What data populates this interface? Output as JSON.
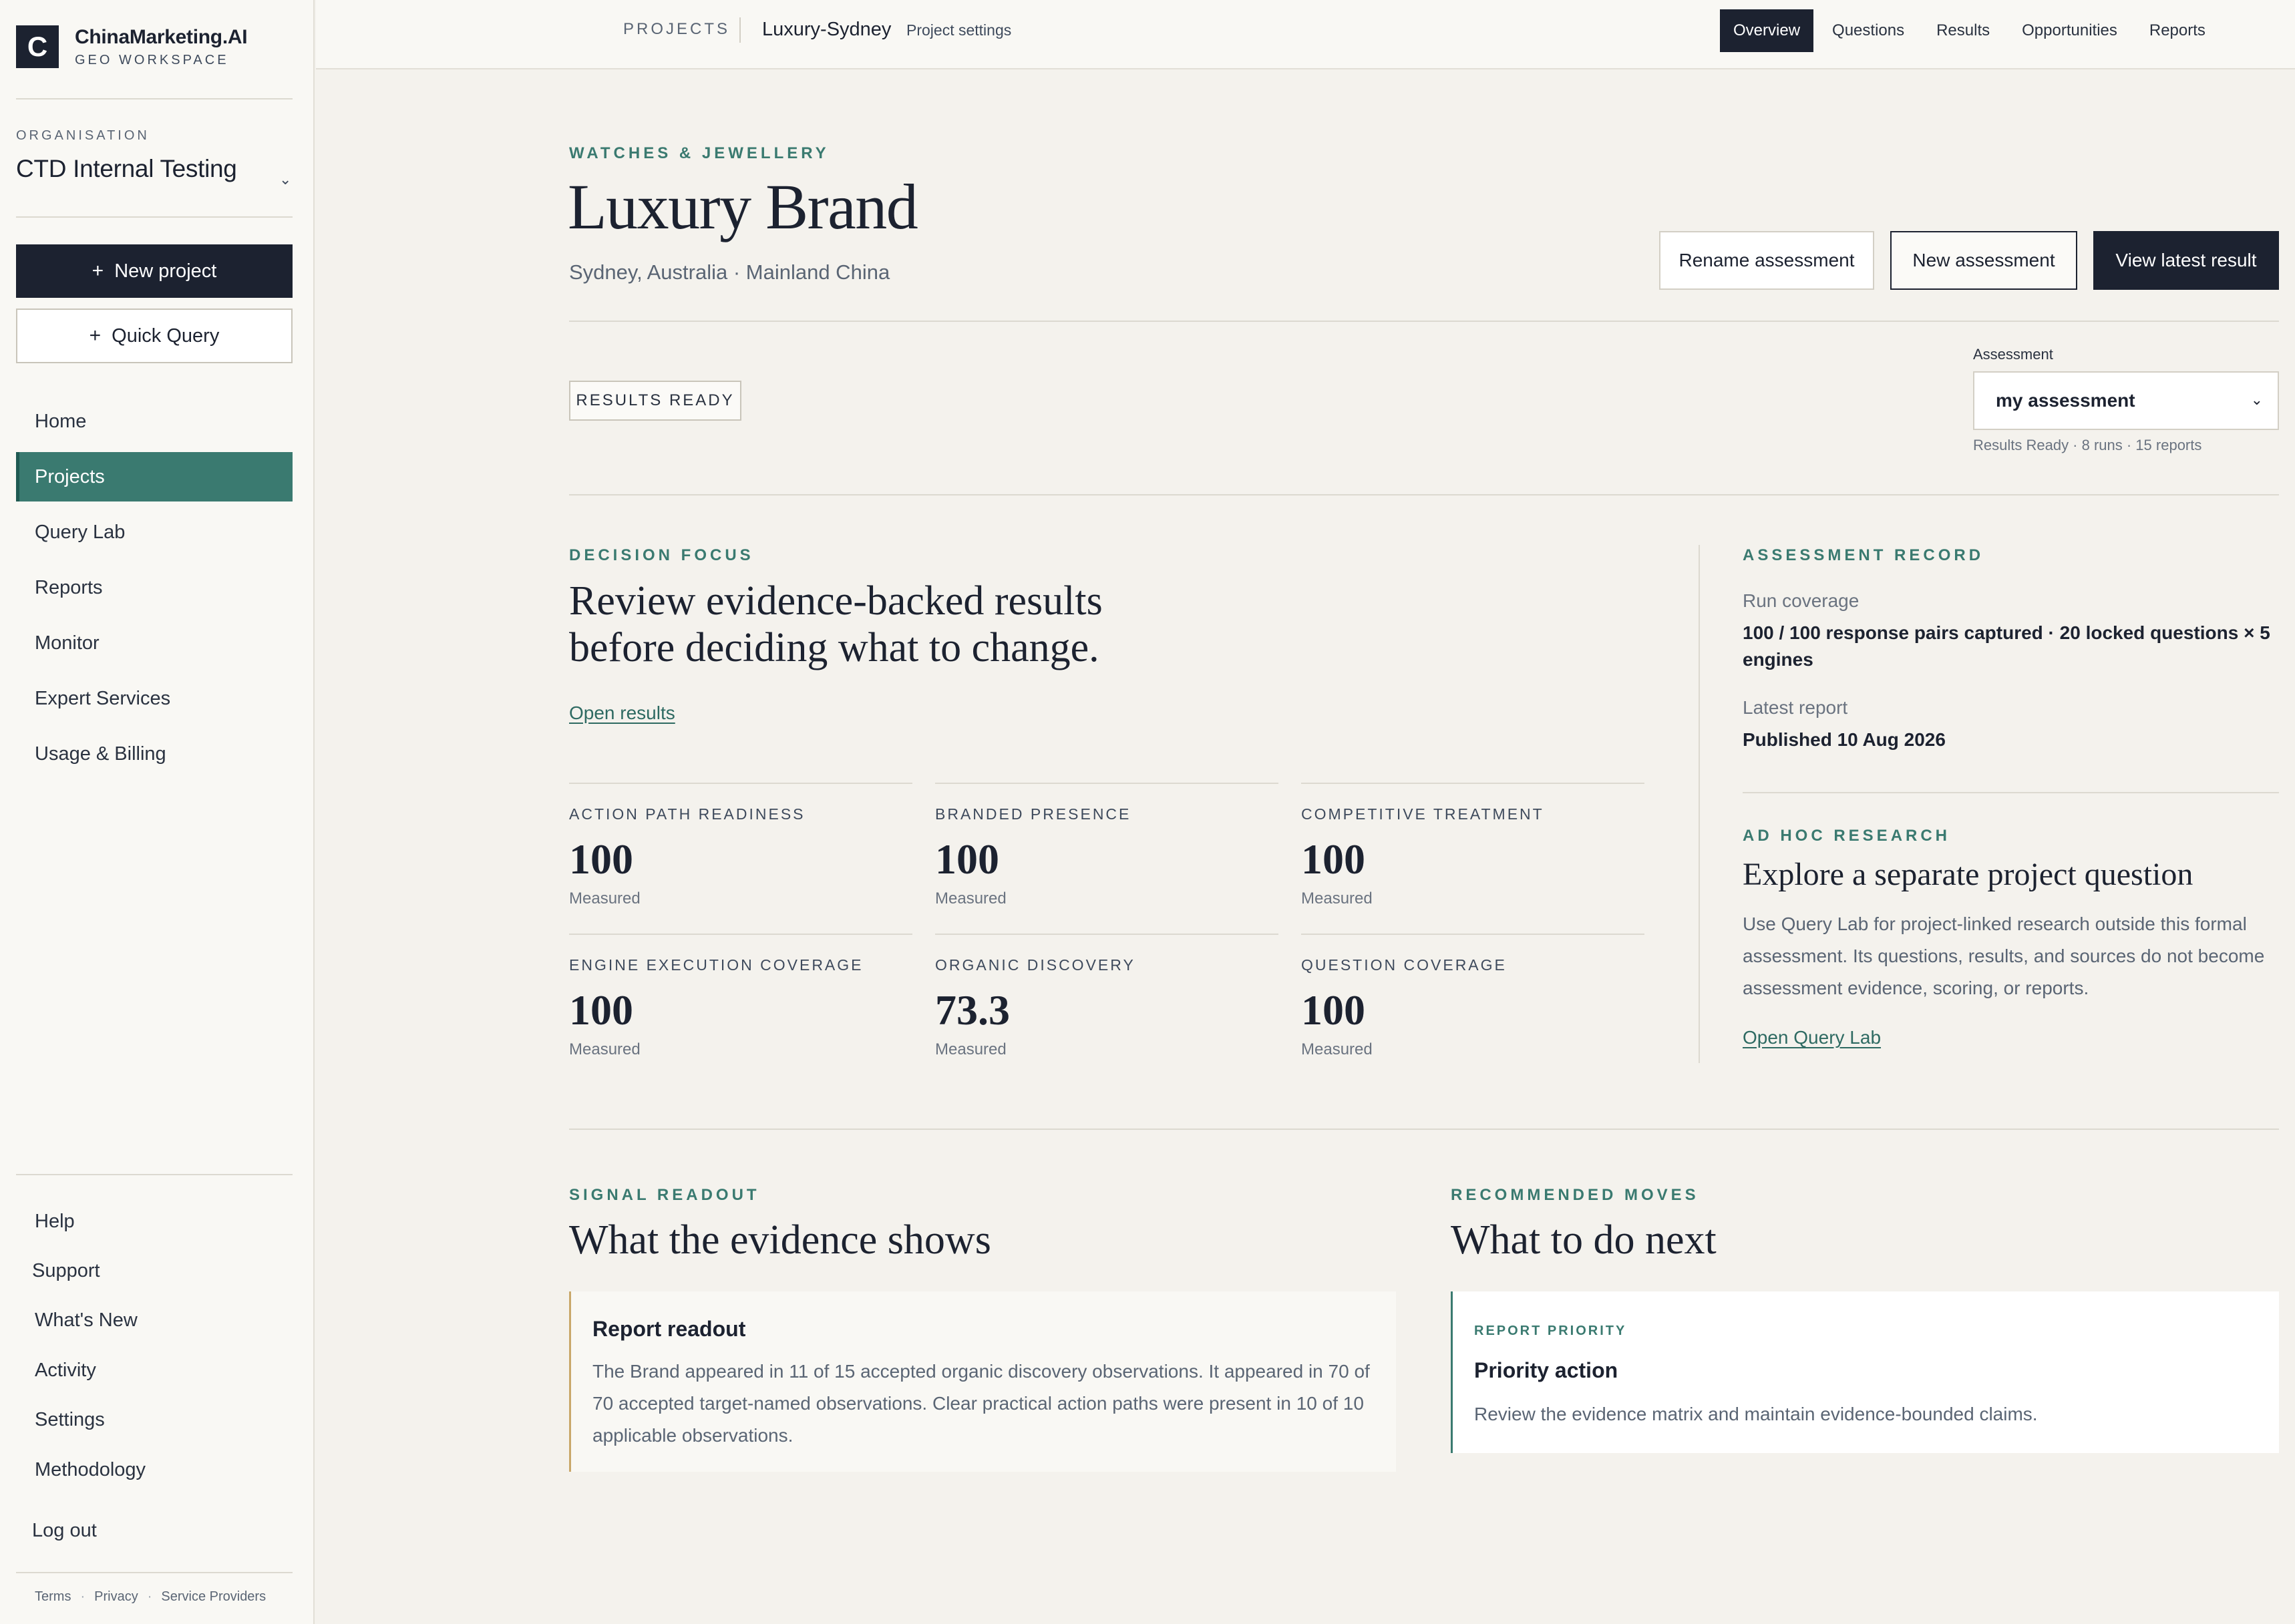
{
  "sidebar": {
    "brand_letter": "C",
    "brand_name": "ChinaMarketing.AI",
    "brand_sub": "GEO WORKSPACE",
    "org_label": "ORGANISATION",
    "org_name": "CTD Internal Testing",
    "new_project": "New project",
    "quick_query": "Quick Query",
    "nav": [
      "Home",
      "Projects",
      "Query Lab",
      "Reports",
      "Monitor",
      "Expert Services",
      "Usage & Billing"
    ],
    "active_nav": "Projects",
    "footer": [
      "Help",
      "Support",
      "What's New",
      "Activity",
      "Settings",
      "Methodology"
    ],
    "logout": "Log out",
    "legal": [
      "Terms",
      "Privacy",
      "Service Providers"
    ]
  },
  "topbar": {
    "projects": "PROJECTS",
    "current": "Luxury-Sydney",
    "settings": "Project settings",
    "tabs": [
      "Overview",
      "Questions",
      "Results",
      "Opportunities",
      "Reports"
    ],
    "active_tab": "Overview"
  },
  "header": {
    "category": "WATCHES & JEWELLERY",
    "title": "Luxury Brand",
    "subtitle": "Sydney, Australia · Mainland China",
    "rename": "Rename assessment",
    "new_assessment": "New assessment",
    "view_latest": "View latest result"
  },
  "status": {
    "badge": "RESULTS READY",
    "assessment_label": "Assessment",
    "assessment_value": "my assessment",
    "assessment_meta": "Results Ready · 8 runs · 15 reports"
  },
  "decision": {
    "eyebrow": "DECISION FOCUS",
    "line1": "Review evidence-backed results",
    "line2": "before deciding what to change.",
    "link": "Open results"
  },
  "metrics": [
    {
      "label": "ACTION PATH READINESS",
      "value": "100",
      "status": "Measured"
    },
    {
      "label": "BRANDED PRESENCE",
      "value": "100",
      "status": "Measured"
    },
    {
      "label": "COMPETITIVE TREATMENT",
      "value": "100",
      "status": "Measured"
    },
    {
      "label": "ENGINE EXECUTION COVERAGE",
      "value": "100",
      "status": "Measured"
    },
    {
      "label": "ORGANIC DISCOVERY",
      "value": "73.3",
      "status": "Measured"
    },
    {
      "label": "QUESTION COVERAGE",
      "value": "100",
      "status": "Measured"
    }
  ],
  "record": {
    "eyebrow": "ASSESSMENT RECORD",
    "run_label": "Run coverage",
    "run_line1": "100 / 100 response pairs captured · 20 locked questions × 5",
    "run_line2": "engines",
    "report_label": "Latest report",
    "report_value": "Published 10 Aug 2026"
  },
  "adhoc": {
    "eyebrow": "AD HOC RESEARCH",
    "title": "Explore a separate project question",
    "line1": "Use Query Lab for project-linked research outside this formal",
    "line2": "assessment. Its questions, results, and sources do not become",
    "line3": "assessment evidence, scoring, or reports.",
    "link": "Open Query Lab"
  },
  "signal": {
    "eyebrow": "SIGNAL READOUT",
    "title": "What the evidence shows",
    "card_title": "Report readout",
    "line1": "The Brand appeared in 11 of 15 accepted organic discovery observations. It appeared in 70 of",
    "line2": "70 accepted target-named observations. Clear practical action paths were present in 10 of 10",
    "line3": "applicable observations."
  },
  "moves": {
    "eyebrow": "RECOMMENDED MOVES",
    "title": "What to do next",
    "card_eyebrow": "REPORT PRIORITY",
    "card_title": "Priority action",
    "card_text": "Review the evidence matrix and maintain evidence-bounded claims."
  }
}
